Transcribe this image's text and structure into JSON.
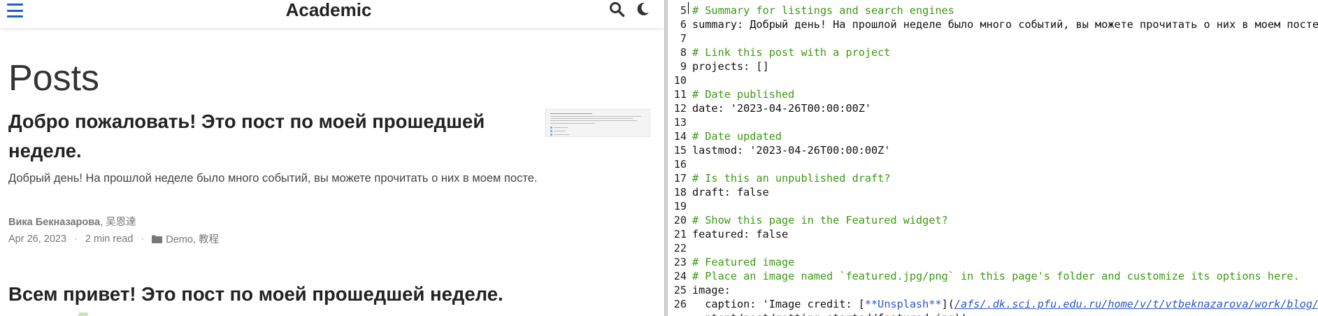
{
  "site": {
    "brand": "Academic",
    "page_title": "Posts",
    "posts": [
      {
        "title": "Добро пожаловать! Это пост по моей прошедшей неделе.",
        "summary": "Добрый день! На прошлой неделе было много событий, вы можете прочитать о них в моем посте.",
        "author_primary": "Вика Бекназарова",
        "author_secondary": ", 吴恩達",
        "date": "Apr 26, 2023",
        "read_time": "2 min read",
        "separator": "·",
        "categories": "Demo, 教程"
      },
      {
        "title": "Всем привет! Это пост по моей прошедшей неделе."
      }
    ],
    "icons": {
      "menu": "hamburger-menu-icon",
      "search": "search-icon",
      "theme": "moon-icon",
      "folder": "folder-icon"
    },
    "colors": {
      "accent": "#1565c0",
      "text": "#222222",
      "muted": "#777777"
    }
  },
  "editor": {
    "colors": {
      "comment": "#3c9a14",
      "link": "#2a56c6",
      "text": "#111111"
    },
    "lines": [
      {
        "n": "5",
        "text": "# Summary for listings and search engines",
        "kind": "comment"
      },
      {
        "n": "6",
        "text": "summary: Добрый день! На прошлой неделе было много событий, вы можете прочитать о них в моем посте.",
        "kind": "code"
      },
      {
        "n": "7",
        "text": "",
        "kind": "code"
      },
      {
        "n": "8",
        "text": "# Link this post with a project",
        "kind": "comment"
      },
      {
        "n": "9",
        "text": "projects: []",
        "kind": "code"
      },
      {
        "n": "10",
        "text": "",
        "kind": "code"
      },
      {
        "n": "11",
        "text": "# Date published",
        "kind": "comment"
      },
      {
        "n": "12",
        "text": "date: '2023-04-26T00:00:00Z'",
        "kind": "code"
      },
      {
        "n": "13",
        "text": "",
        "kind": "code"
      },
      {
        "n": "14",
        "text": "# Date updated",
        "kind": "comment"
      },
      {
        "n": "15",
        "text": "lastmod: '2023-04-26T00:00:00Z'",
        "kind": "code"
      },
      {
        "n": "16",
        "text": "",
        "kind": "code"
      },
      {
        "n": "17",
        "text": "# Is this an unpublished draft?",
        "kind": "comment"
      },
      {
        "n": "18",
        "text": "draft: false",
        "kind": "code"
      },
      {
        "n": "19",
        "text": "",
        "kind": "code"
      },
      {
        "n": "20",
        "text": "# Show this page in the Featured widget?",
        "kind": "comment"
      },
      {
        "n": "21",
        "text": "featured: false",
        "kind": "code"
      },
      {
        "n": "22",
        "text": "",
        "kind": "code"
      },
      {
        "n": "23",
        "text": "# Featured image",
        "kind": "comment"
      },
      {
        "n": "24",
        "text": "# Place an image named `featured.jpg/png` in this page's folder and customize its options here.",
        "kind": "comment"
      },
      {
        "n": "25",
        "text": "image:",
        "kind": "code"
      },
      {
        "n": "26",
        "kind": "caption",
        "pre": "  caption: 'Image credit: [",
        "bold": "**Unsplash**",
        "mid": "](",
        "link": "/afs/.dk.sci.pfu.edu.ru/home/v/t/vtbeknazarova/work/blog/"
      },
      {
        "n": "",
        "text": "  ntent/post/getting-started/featured.jpg)'",
        "kind": "code"
      }
    ]
  }
}
